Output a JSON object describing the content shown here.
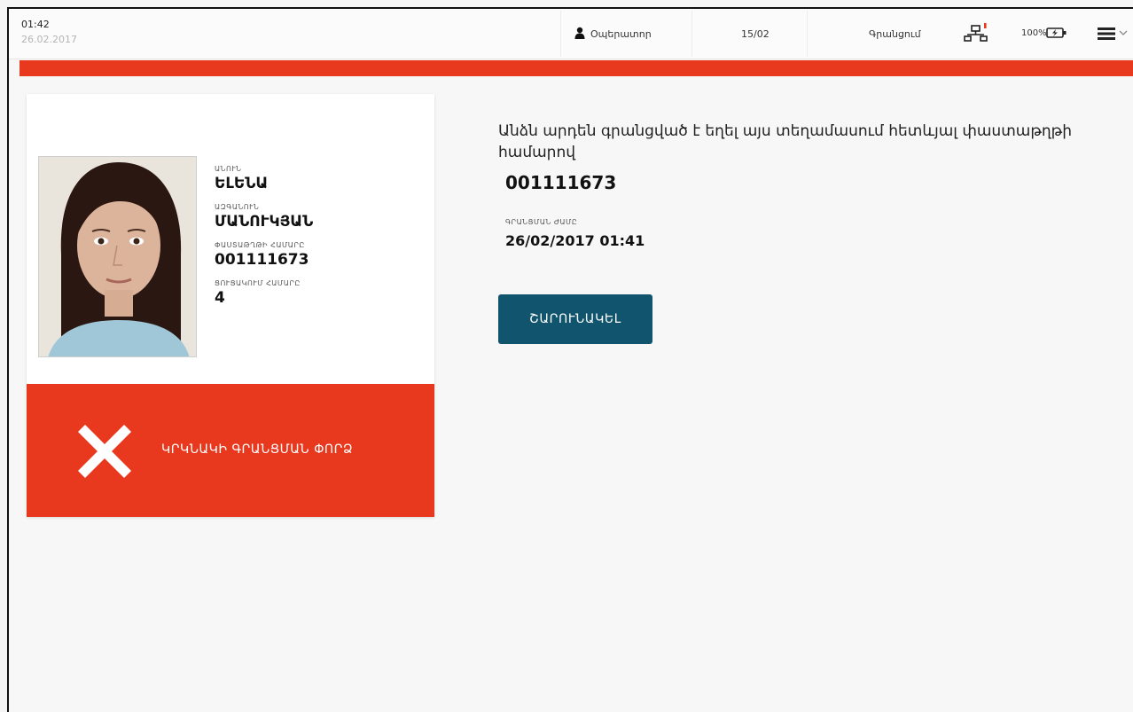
{
  "status": {
    "time": "01:42",
    "date": "26.02.2017"
  },
  "topbar": {
    "operator_label": "Օպերատոր",
    "counter": "15/02",
    "mode_label": "Գրանցում",
    "battery_text": "100%"
  },
  "person": {
    "first_name_label": "ԱՆՈՒՆ",
    "first_name": "ԵԼԵՆԱ",
    "last_name_label": "ԱԶԳԱՆՈՒՆ",
    "last_name": "ՄԱՆՈՒԿՅԱՆ",
    "passport_label": "ՓԱՍՏԱԹՂԹԻ ՀԱՄԱՐԸ",
    "passport_number": "001111673",
    "list_label": "ՑՈՒՑԱԿՈՒՄ ՀԱՄԱՐԸ",
    "list_number": "4"
  },
  "alert": {
    "text": "ԿՐԿՆԱԿԻ ԳՐԱՆՑՄԱՆ ՓՈՐՁ"
  },
  "details": {
    "message": "Անձն արդեն գրանցված է եղել այս տեղամասում հետևյալ փաստաթղթի համարով",
    "passport_number": "001111673",
    "reg_time_label": "ԳՐԱՆՑՄԱՆ ԺԱՄԸ",
    "reg_time": "26/02/2017 01:41"
  },
  "actions": {
    "continue_label": "ՇԱՐՈՒՆԱԿԵԼ"
  },
  "colors": {
    "accent_red": "#e8391f",
    "button_blue": "#11546e"
  }
}
